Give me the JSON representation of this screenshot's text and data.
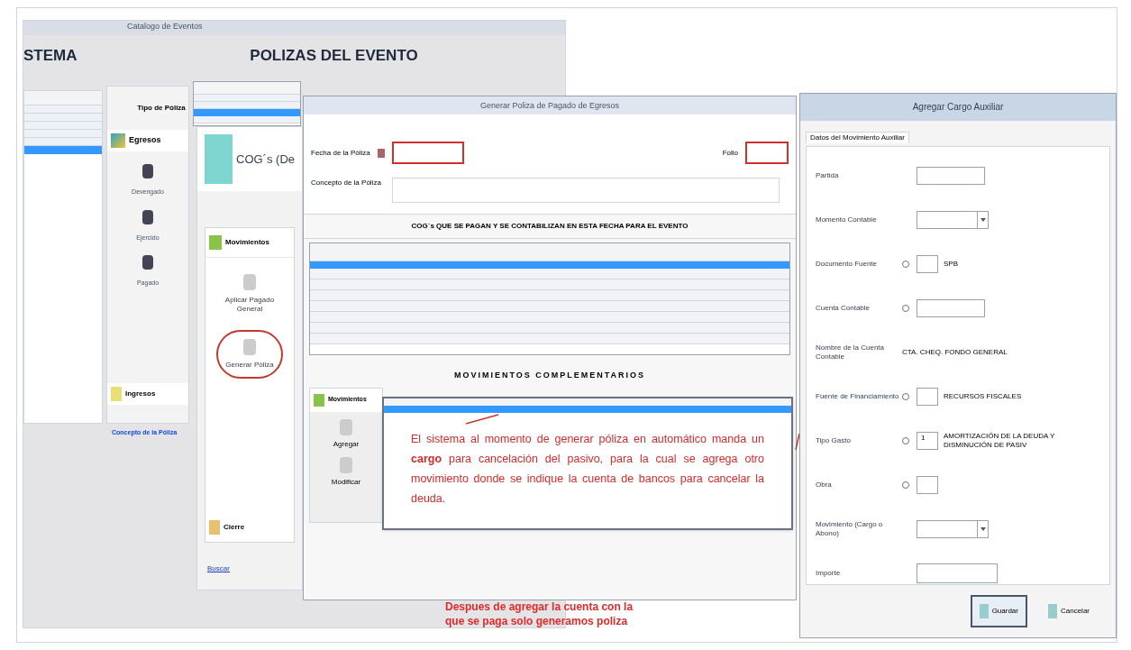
{
  "catalog_window": {
    "title": "Catalogo de Eventos",
    "left_header": "STEMA",
    "main_header": "POLIZAS DEL EVENTO",
    "list_rows": [
      {
        "selected": false
      },
      {
        "selected": false
      },
      {
        "selected": false
      },
      {
        "selected": false
      },
      {
        "selected": false
      },
      {
        "selected": true
      }
    ],
    "policy_types": {
      "header": "Tipo de Póliza",
      "group": "Egresos",
      "items": [
        {
          "label": "Devengado"
        },
        {
          "label": "Ejercido"
        },
        {
          "label": "Pagado"
        }
      ],
      "footer_group": "Ingresos"
    },
    "concept_link": "Concepto de la Póliza",
    "policy_rows": [
      {
        "selected": false
      },
      {
        "selected": false
      },
      {
        "selected": true
      },
      {
        "selected": false
      }
    ]
  },
  "cog_window": {
    "title": "COG´s (De",
    "group": "Movimientos",
    "items": [
      {
        "label": "Aplicar Pagado General",
        "highlighted": false
      },
      {
        "label": "Generar Póliza",
        "highlighted": true
      }
    ],
    "footer_group": "Cierre",
    "search_link": "Buscar"
  },
  "generate_window": {
    "title": "Generar Poliza de Pagado de Egresos",
    "date_label": "Fecha de la Póliza",
    "date_highlighted": true,
    "folio_label": "Folio",
    "folio_highlighted": true,
    "concept_label": "Concepto de la Póliza",
    "section_title": "COG´s QUE SE PAGAN Y SE CONTABILIZAN EN ESTA FECHA PARA EL EVENTO",
    "cog_rows": [
      {
        "selected": true
      },
      {
        "selected": false
      },
      {
        "selected": false
      },
      {
        "selected": false
      },
      {
        "selected": false
      },
      {
        "selected": false
      },
      {
        "selected": false
      },
      {
        "selected": false
      }
    ],
    "moves_title": "MOVIMIENTOS COMPLEMENTARIOS",
    "moves_group": "Movimientos",
    "moves_items": [
      {
        "label": "Agregar"
      },
      {
        "label": "Modificar"
      }
    ],
    "move_rows": [
      {
        "selected": true
      }
    ]
  },
  "annotation": {
    "text": "El sistema al momento de generar póliza en automático manda un **cargo** para cancelación del pasivo, para la cual se agrega otro movimiento donde se indique la cuenta de bancos para cancelar la deuda."
  },
  "bottom_note": "Despues de agregar la cuenta con la que se paga solo generamos poliza",
  "aux_window": {
    "title": "Agregar Cargo Auxiliar",
    "tab": "Datos del Movimiento Auxiliar",
    "fields": [
      {
        "kind": "text",
        "label": "Partida",
        "lookup": false
      },
      {
        "kind": "select",
        "label": "Momento Contable",
        "lookup": false
      },
      {
        "kind": "code",
        "label": "Documento Fuente",
        "lookup": true,
        "description": "SPB"
      },
      {
        "kind": "text",
        "label": "Cuenta Contable",
        "lookup": true
      },
      {
        "kind": "info",
        "label": "Nombre de la Cuenta Contable",
        "description": "CTA. CHEQ. FONDO GENERAL"
      },
      {
        "kind": "code",
        "label": "Fuente de Financiamiento",
        "lookup": true,
        "description": "RECURSOS FISCALES"
      },
      {
        "kind": "code",
        "label": "Tipo Gasto",
        "lookup": true,
        "value": "1",
        "description": "AMORTIZACIÓN DE LA DEUDA Y DISMINUCIÓN DE PASIV"
      },
      {
        "kind": "code",
        "label": "Obra",
        "lookup": true
      },
      {
        "kind": "select",
        "label": "Movimiento (Cargo o Abono)",
        "lookup": false
      },
      {
        "kind": "amount",
        "label": "Importe",
        "lookup": false
      }
    ],
    "buttons": [
      {
        "label": "Guardar",
        "default": true
      },
      {
        "label": "Cancelar",
        "default": false
      }
    ]
  }
}
